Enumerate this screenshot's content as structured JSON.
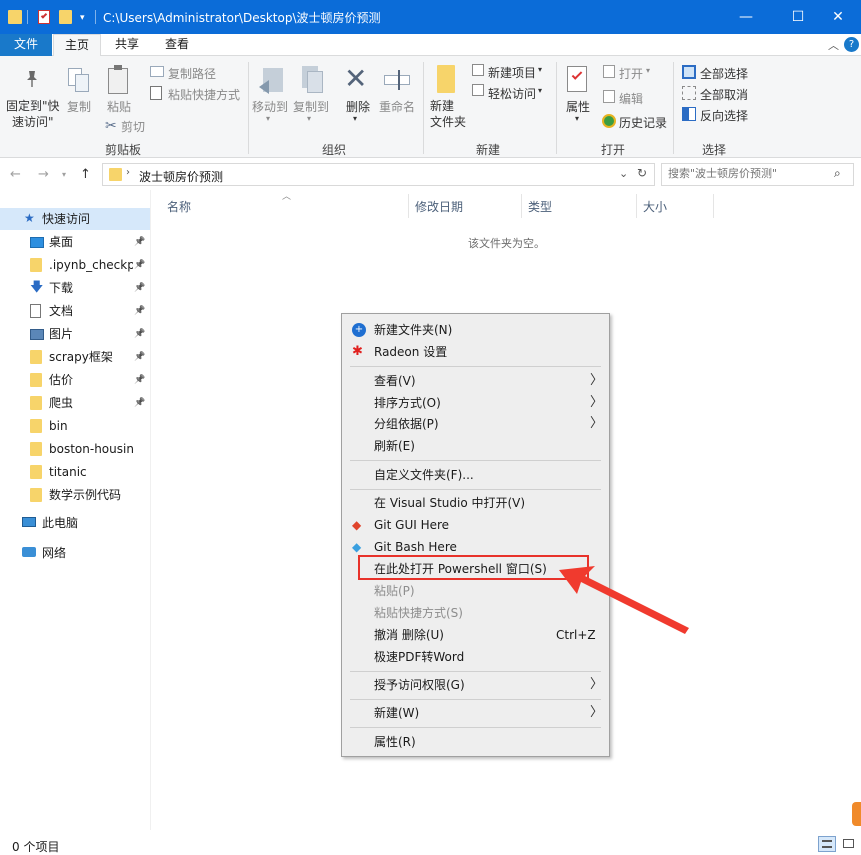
{
  "window": {
    "path": "C:\\Users\\Administrator\\Desktop\\波士顿房价预测",
    "minimize": "—",
    "maximize": "☐",
    "close": "✕"
  },
  "tabs": {
    "file": "文件",
    "home": "主页",
    "share": "共享",
    "view": "查看",
    "help": "?"
  },
  "ribbon": {
    "clipboard": {
      "pin_label": "固定到\"快\n速访问\"",
      "copy": "复制",
      "paste": "粘贴",
      "copy_path": "复制路径",
      "paste_shortcut": "粘贴快捷方式",
      "cut": "剪切",
      "group": "剪贴板"
    },
    "organize": {
      "move_to": "移动到",
      "copy_to": "复制到",
      "delete": "删除",
      "rename": "重命名",
      "group": "组织"
    },
    "new": {
      "new_folder": "新建\n文件夹",
      "new_item": "新建项目",
      "easy_access": "轻松访问",
      "group": "新建"
    },
    "open": {
      "properties": "属性",
      "open": "打开",
      "edit": "编辑",
      "history": "历史记录",
      "group": "打开"
    },
    "select": {
      "select_all": "全部选择",
      "select_none": "全部取消",
      "invert": "反向选择",
      "group": "选择"
    }
  },
  "address": {
    "crumb": "波士顿房价预测",
    "search_placeholder": "搜索\"波士顿房价预测\""
  },
  "nav": {
    "quick_access": "快速访问",
    "items": [
      {
        "label": "桌面",
        "pinned": true
      },
      {
        "label": ".ipynb_checkpc",
        "pinned": true
      },
      {
        "label": "下载",
        "pinned": true
      },
      {
        "label": "文档",
        "pinned": true
      },
      {
        "label": "图片",
        "pinned": true
      },
      {
        "label": "scrapy框架",
        "pinned": true
      },
      {
        "label": "估价",
        "pinned": true
      },
      {
        "label": "爬虫",
        "pinned": true
      },
      {
        "label": "bin",
        "pinned": false
      },
      {
        "label": "boston-housing",
        "pinned": false
      },
      {
        "label": "titanic",
        "pinned": false
      },
      {
        "label": "数学示例代码",
        "pinned": false
      }
    ],
    "this_pc": "此电脑",
    "network": "网络"
  },
  "columns": {
    "name": "名称",
    "modified": "修改日期",
    "type": "类型",
    "size": "大小"
  },
  "empty_text": "该文件夹为空。",
  "context_menu": {
    "new_folder": "新建文件夹(N)",
    "radeon": "Radeon 设置",
    "view": "查看(V)",
    "sort": "排序方式(O)",
    "group": "分组依据(P)",
    "refresh": "刷新(E)",
    "customize": "自定义文件夹(F)...",
    "vs": "在 Visual Studio 中打开(V)",
    "git_gui": "Git GUI Here",
    "git_bash": "Git Bash Here",
    "powershell": "在此处打开 Powershell 窗口(S)",
    "paste": "粘贴(P)",
    "paste_shortcut": "粘贴快捷方式(S)",
    "undo": "撤消 删除(U)",
    "undo_shortcut": "Ctrl+Z",
    "pdf": "极速PDF转Word",
    "grant": "授予访问权限(G)",
    "new": "新建(W)",
    "properties": "属性(R)"
  },
  "status": {
    "count": "0 个项目"
  },
  "colors": {
    "titlebar": "#0b6cd8",
    "file_tab": "#1979ca",
    "highlight": "#e8322a"
  }
}
